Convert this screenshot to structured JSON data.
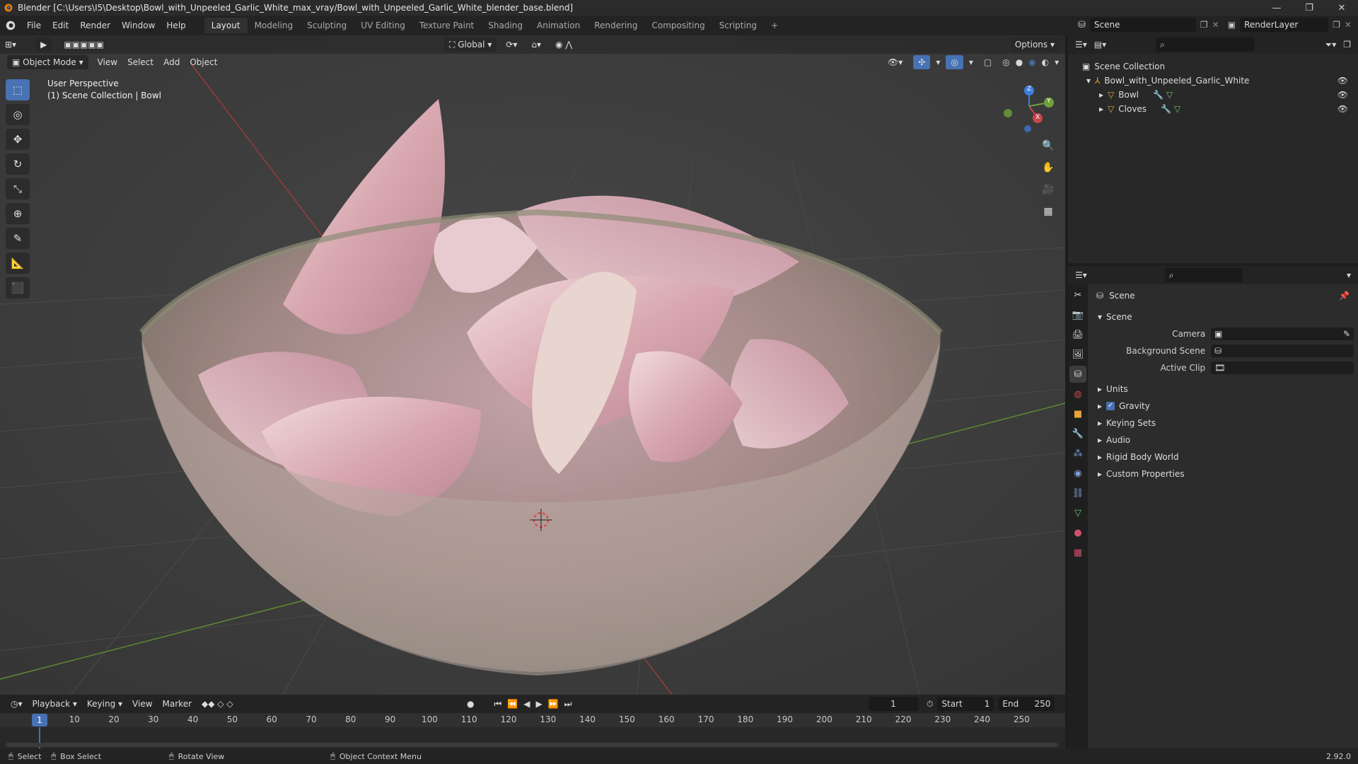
{
  "window": {
    "title": "Blender [C:\\Users\\I5\\Desktop\\Bowl_with_Unpeeled_Garlic_White_max_vray/Bowl_with_Unpeeled_Garlic_White_blender_base.blend]",
    "minimize": "—",
    "maximize": "❐",
    "close": "✕"
  },
  "menu": {
    "items": [
      "File",
      "Edit",
      "Render",
      "Window",
      "Help"
    ],
    "workspaces": [
      "Layout",
      "Modeling",
      "Sculpting",
      "UV Editing",
      "Texture Paint",
      "Shading",
      "Animation",
      "Rendering",
      "Compositing",
      "Scripting"
    ],
    "add_tab": "+",
    "scene_label": "Scene",
    "render_layer": "RenderLayer"
  },
  "viewport": {
    "mode": "Object Mode",
    "menus": [
      "View",
      "Select",
      "Add",
      "Object"
    ],
    "transform_orientation": "Global",
    "options": "Options",
    "perspective": "User Perspective",
    "collection_path": "(1) Scene Collection | Bowl",
    "gizmo_labels": {
      "z": "Z",
      "y": "Y",
      "x": "X"
    }
  },
  "outliner": {
    "root": "Scene Collection",
    "collection": "Bowl_with_Unpeeled_Garlic_White",
    "objects": [
      "Bowl",
      "Cloves"
    ]
  },
  "properties": {
    "header": "Scene",
    "panel_title": "Scene",
    "fields": [
      {
        "label": "Camera",
        "value": ""
      },
      {
        "label": "Background Scene",
        "value": ""
      },
      {
        "label": "Active Clip",
        "value": ""
      }
    ],
    "subpanels": [
      "Units",
      "Gravity",
      "Keying Sets",
      "Audio",
      "Rigid Body World",
      "Custom Properties"
    ],
    "gravity_checked": true
  },
  "timeline": {
    "menus": [
      "Playback",
      "Keying",
      "View",
      "Marker"
    ],
    "current_frame": "1",
    "start_label": "Start",
    "start": "1",
    "end_label": "End",
    "end": "250",
    "ruler_current": "1",
    "ruler_ticks": [
      "10",
      "20",
      "30",
      "40",
      "50",
      "60",
      "70",
      "80",
      "90",
      "100",
      "110",
      "120",
      "130",
      "140",
      "150",
      "160",
      "170",
      "180",
      "190",
      "200",
      "210",
      "220",
      "230",
      "240",
      "250"
    ]
  },
  "status": {
    "select": "Select",
    "box_select": "Box Select",
    "rotate_view": "Rotate View",
    "context_menu": "Object Context Menu",
    "version": "2.92.0"
  },
  "colors": {
    "accent": "#4772b3",
    "x_axis": "#c8464a",
    "y_axis": "#6fa03a",
    "z_axis": "#3d7ee0"
  }
}
